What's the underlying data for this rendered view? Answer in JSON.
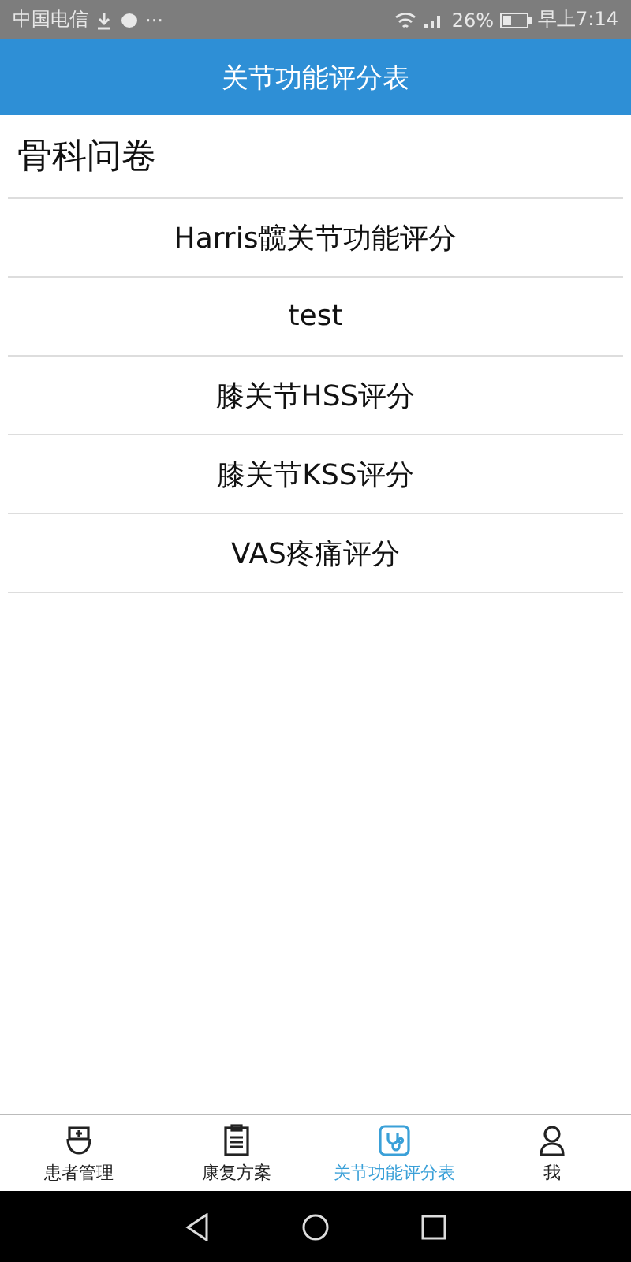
{
  "status_bar": {
    "carrier": "中国电信",
    "more": "···",
    "battery": "26%",
    "time": "早上7:14"
  },
  "header": {
    "title": "关节功能评分表"
  },
  "section": {
    "title": "骨科问卷"
  },
  "items": [
    {
      "label": "Harris髋关节功能评分"
    },
    {
      "label": "test"
    },
    {
      "label": "膝关节HSS评分"
    },
    {
      "label": "膝关节KSS评分"
    },
    {
      "label": "VAS疼痛评分"
    }
  ],
  "tabs": [
    {
      "label": "患者管理",
      "selected": false
    },
    {
      "label": "康复方案",
      "selected": false
    },
    {
      "label": "关节功能评分表",
      "selected": true
    },
    {
      "label": "我",
      "selected": false
    }
  ]
}
